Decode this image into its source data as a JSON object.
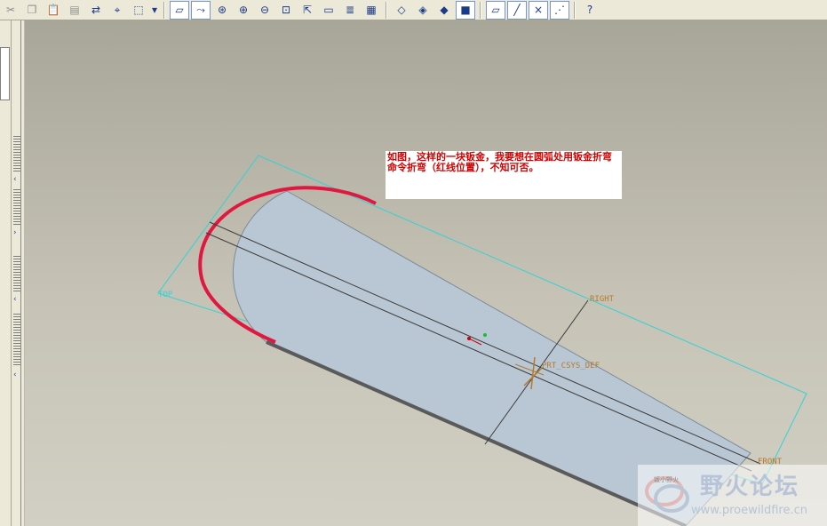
{
  "toolbar": {
    "buttons": [
      {
        "name": "cut-icon",
        "glyph": "✂"
      },
      {
        "name": "copy-icon",
        "glyph": "❐"
      },
      {
        "name": "paste-icon",
        "glyph": "📋"
      },
      {
        "name": "paste-special-icon",
        "glyph": "▤"
      },
      {
        "name": "regenerate-icon",
        "glyph": "⇄"
      },
      {
        "name": "find-icon",
        "glyph": "⌖"
      },
      {
        "name": "select-box-icon",
        "glyph": "⬚"
      },
      {
        "name": "datum-planes-icon",
        "glyph": "▱"
      },
      {
        "name": "datum-axes-icon",
        "glyph": "⤳"
      },
      {
        "name": "spin-center-icon",
        "glyph": "⊛"
      },
      {
        "name": "zoom-in-icon",
        "glyph": "⊕"
      },
      {
        "name": "zoom-out-icon",
        "glyph": "⊖"
      },
      {
        "name": "refit-icon",
        "glyph": "⊡"
      },
      {
        "name": "reorient-icon",
        "glyph": "⇱"
      },
      {
        "name": "saved-views-icon",
        "glyph": "▭"
      },
      {
        "name": "layers-icon",
        "glyph": "≣"
      },
      {
        "name": "view-manager-icon",
        "glyph": "▦"
      },
      {
        "name": "wireframe-icon",
        "glyph": "◇"
      },
      {
        "name": "hidden-line-icon",
        "glyph": "◈"
      },
      {
        "name": "no-hidden-icon",
        "glyph": "◆"
      },
      {
        "name": "shading-icon",
        "glyph": "■"
      },
      {
        "name": "datum-plane-display-icon",
        "glyph": "▱"
      },
      {
        "name": "datum-axis-display-icon",
        "glyph": "╱"
      },
      {
        "name": "datum-point-display-icon",
        "glyph": "×"
      },
      {
        "name": "csys-display-icon",
        "glyph": "⋰"
      },
      {
        "name": "context-help-icon",
        "glyph": "?"
      }
    ]
  },
  "note": {
    "text": "如图，这样的一块钣金，我要想在圆弧处用钣金折弯命令折弯（红线位置），不知可否。"
  },
  "datums": {
    "right": "RIGHT",
    "front": "FRONT",
    "top": "TOP",
    "csys": "PRT_CSYS_DEF"
  },
  "watermark": {
    "title": "野火论坛",
    "url": "www.proewildfire.cn",
    "tiny": "钣小野火"
  },
  "colors": {
    "part_fill": "#b8c7d3",
    "datum_cyan": "#33d1d6",
    "bend_red": "#e0173f",
    "edge_dark": "#5a5a5a"
  }
}
